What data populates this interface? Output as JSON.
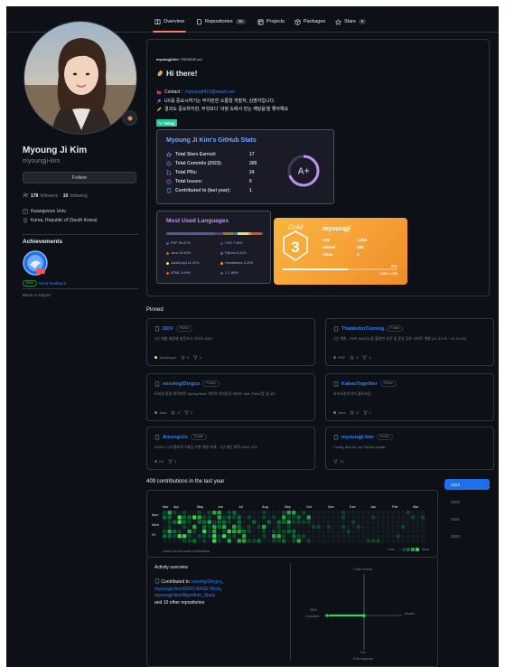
{
  "nav": {
    "tabs": [
      {
        "label": "Overview",
        "icon": "book-icon",
        "selected": true
      },
      {
        "label": "Repositories",
        "icon": "repo-icon",
        "count": "28"
      },
      {
        "label": "Projects",
        "icon": "table-icon"
      },
      {
        "label": "Packages",
        "icon": "package-icon"
      },
      {
        "label": "Stars",
        "icon": "star-icon",
        "count": "9"
      }
    ]
  },
  "profile": {
    "full_name": "Myoung Ji Kim",
    "login": "myoungji-kim",
    "follow_label": "Follow",
    "followers_count": "178",
    "followers_label": "followers",
    "following_count": "10",
    "following_label": "following",
    "organization": "Kwangwoon Univ.",
    "location": "Korea, Republic of (South Korea)",
    "achievements_title": "Achievements",
    "beta_label": "Beta",
    "feedback_label": "Send feedback",
    "block_report": "Block or Report"
  },
  "readme": {
    "path_owner": "myoungji-kim",
    "path_file": "README.md",
    "heading": "Hi there!",
    "contact_prefix": "Contact :",
    "contact_email": "myoung9412@daum.net",
    "line_ux": "UX를 중요시여기는 부지런한 소통형 개발자, 김명지입니다.",
    "line_result": "결과도 중요하지만, 무엇보다 '과정 속에서 얻는 깨달음'을 좋아해요",
    "velog_label": "Velog"
  },
  "stats_card": {
    "title": "Myoung Ji Kim's GitHub Stats",
    "rows": [
      {
        "label": "Total Stars Earned:",
        "value": "17",
        "icon": "star-icon"
      },
      {
        "label": "Total Commits (2023):",
        "value": "205",
        "icon": "clock-icon"
      },
      {
        "label": "Total PRs:",
        "value": "24",
        "icon": "pr-icon"
      },
      {
        "label": "Total Issues:",
        "value": "0",
        "icon": "issue-icon"
      },
      {
        "label": "Contributed to (last year):",
        "value": "1",
        "icon": "repo-icon"
      }
    ],
    "rank": "A+",
    "title_color": "#70a5fd",
    "ring_color": "#bf91f3"
  },
  "langs_card": {
    "title": "Most Used Languages",
    "languages": [
      {
        "name": "PHP 50.57%",
        "percent": 50.57,
        "color": "#4F5D95"
      },
      {
        "name": "CSS 7.95%",
        "percent": 7.95,
        "color": "#563d7c"
      },
      {
        "name": "Java 10.40%",
        "percent": 10.4,
        "color": "#b07219"
      },
      {
        "name": "Python 5.11%",
        "percent": 5.11,
        "color": "#3572A5"
      },
      {
        "name": "JavaScript 11.02%",
        "percent": 11.02,
        "color": "#f1e05a"
      },
      {
        "name": "Handlebars 3.20%",
        "percent": 3.2,
        "color": "#f7931e"
      },
      {
        "name": "HTML 9.99%",
        "percent": 9.99,
        "color": "#e34c26"
      },
      {
        "name": "C 1.86%",
        "percent": 1.86,
        "color": "#555555"
      }
    ]
  },
  "solved_card": {
    "tier": "Gold",
    "tier_level": "3",
    "handle": "myoungji",
    "rows": [
      {
        "key": "rate",
        "value": "1,255"
      },
      {
        "key": "solved",
        "value": "285"
      },
      {
        "key": "class",
        "value": "3"
      }
    ],
    "percent": "57%",
    "progress_fraction": 0.57,
    "progress_text": "1,255 / 1,700"
  },
  "pinned": {
    "title": "Pinned",
    "items": [
      {
        "name": "DDV",
        "badge": "Public",
        "desc": "1인 개발 회원제 설문조사 서비스 DDV",
        "language": "JavaScript",
        "lang_color": "#f1e05a",
        "stars": "5",
        "forks": "1"
      },
      {
        "name": "ThanksforComing",
        "badge": "Public",
        "desc": "1인 개발 - PHP, MySQL을 활용한 사진 및 문상 공유 사이트 개발 (21.07.05 ~ 21.09.02)",
        "language": "PHP",
        "lang_color": "#4F5D95",
        "stars": "2",
        "forks": "3"
      },
      {
        "name": "sosolog/Dingco",
        "badge": "Public",
        "desc": "모바일 환경 최적화된 Spring Boot 기반의 여자동의 서비스 feat. Petal 팀 입니다.",
        "language": "Java",
        "lang_color": "#b07219",
        "stars": "3",
        "forks": "2"
      },
      {
        "name": "KakaoTogether",
        "badge": "Public",
        "desc": "카카오같이가치 클로코딩",
        "language": "Java",
        "lang_color": "#b07219",
        "stars": "6",
        "forks": "1"
      },
      {
        "name": "Among-Us",
        "badge": "Public",
        "desc": "2020-2 시스템프로그래밍 수행 개발 과제 - 1인 개인 재작 UNIX 시스",
        "language": "C#",
        "lang_color": "#178600",
        "stars": "",
        "forks": "1"
      },
      {
        "name": "myoungji-kim",
        "badge": "Public",
        "desc": "Config files for my GitHub profile.",
        "language": "",
        "lang_color": "",
        "stars": "",
        "forks": "12"
      }
    ]
  },
  "contributions": {
    "title": "409 contributions in the last year",
    "months": [
      "Mar",
      "Apr",
      "May",
      "Jun",
      "Jul",
      "Aug",
      "Sep",
      "Oct",
      "Nov",
      "Dec",
      "Jan",
      "Feb",
      "Mar"
    ],
    "weekdays": [
      "Mon",
      "Wed",
      "Fri"
    ],
    "learn_link": "Learn how we count contributions",
    "less_label": "Less",
    "more_label": "More",
    "years": [
      "2023",
      "2022",
      "2021",
      "2020"
    ],
    "colors": [
      "#161b22",
      "#0e4429",
      "#006d32",
      "#26a641",
      "#39d353"
    ]
  },
  "activity": {
    "title": "Activity overview",
    "contributed_prefix": "Contributed to",
    "repos": [
      "sosolog/Dingco",
      "myoungji-kim/ZERO-BASE-Work",
      "myoungji-kim/Algorithm_Study"
    ],
    "other": "and 10 other repositories",
    "axis": {
      "code_review": "Code review",
      "issues": "Issues",
      "commits_pct": "95%",
      "commits": "Commits",
      "prs_pct": "5%",
      "prs": "Pull requests"
    },
    "commits_pct_value": 95,
    "prs_pct_value": 5,
    "line_color": "#39d353"
  }
}
